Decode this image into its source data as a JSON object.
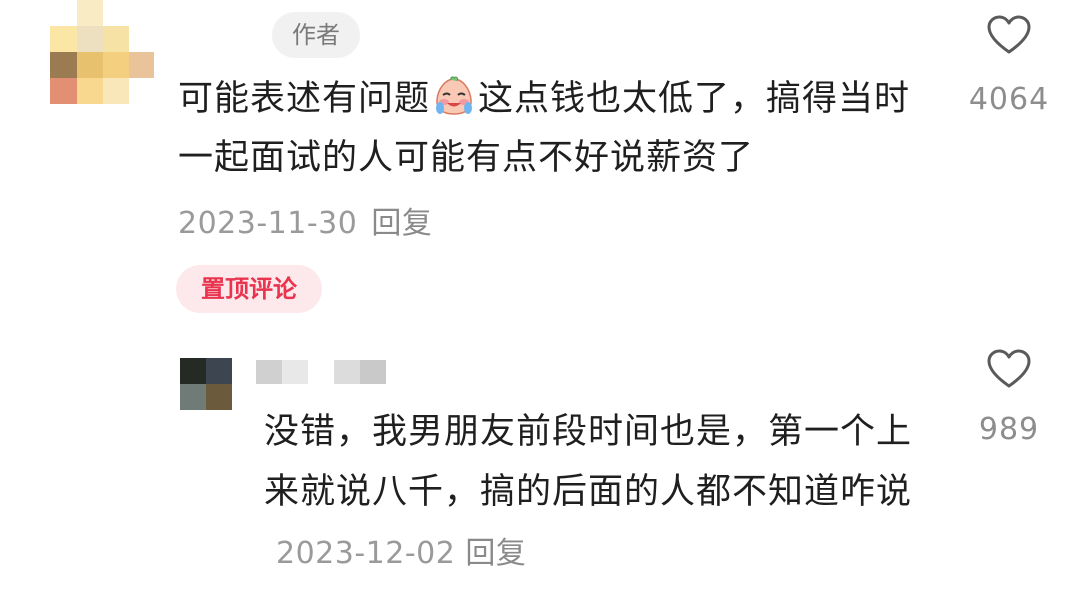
{
  "main_comment": {
    "author_badge": "作者",
    "text_before_emoji": "可能表述有问题",
    "emoji": "crying-face",
    "text_after_emoji": "这点钱也太低了，搞得当时一起面试的人可能有点不好说薪资了",
    "date": "2023-11-30",
    "reply_label": "回复",
    "likes": "4064",
    "pinned_label": "置顶评论"
  },
  "reply_comment": {
    "text": "没错，我男朋友前段时间也是，第一个上来就说八千，搞的后面的人都不知道咋说",
    "date": "2023-12-02",
    "reply_label": "回复",
    "likes": "989"
  },
  "colors": {
    "text": "#1f1f1f",
    "meta": "#9a9a9a",
    "pinned_bg": "#fde9ec",
    "pinned_text": "#e8344e",
    "badge_bg": "#f1f1f1"
  }
}
